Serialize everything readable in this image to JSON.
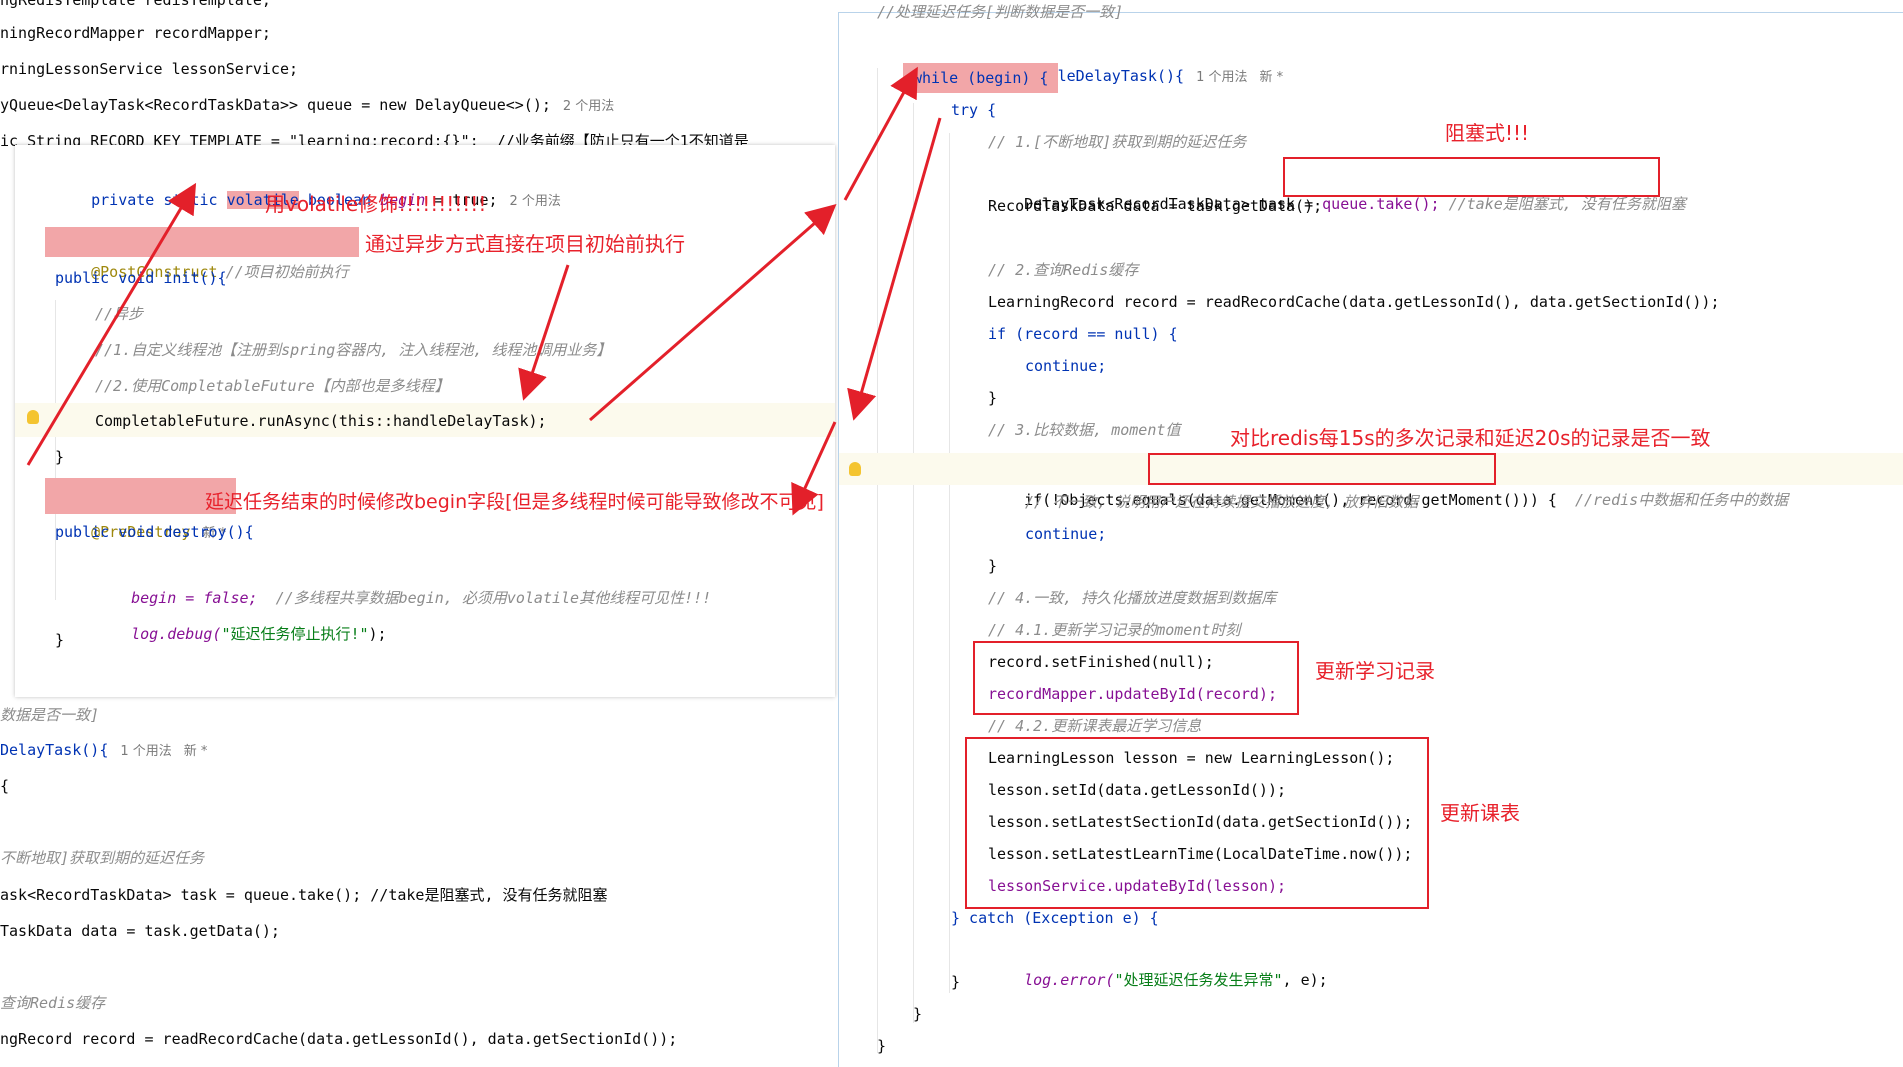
{
  "bg_lines": [
    "ngRedisTemplate redisTemplate;",
    "ningRecordMapper recordMapper;",
    "rningLessonService lessonService;",
    "yQueue<DelayTask<RecordTaskData>> queue = new DelayQueue<>();",
    "ic String RECORD_KEY_TEMPLATE = \"learning:record:{}\";  //业务前缀【防止只有一个1不知道是"
  ],
  "bg_usage_hint": "2 个用法",
  "bg_lower_lines": [
    "数据是否一致]",
    "DelayTask(){",
    "{",
    "不断地取]获取到期的延迟任务",
    "ask<RecordTaskData> task = queue.take(); //take是阻塞式, 没有任务就阻塞",
    "TaskData data = task.getData();",
    "查询Redis缓存",
    "ngRecord record = readRecordCache(data.getLessonId(), data.getSectionId());"
  ],
  "bg_lower_hints": {
    "usage": "1 个用法",
    "new": "新 *"
  },
  "left_panel": {
    "field_line": {
      "pre": "private static ",
      "kw": "volatile",
      "type": " boolean ",
      "name": "begin",
      "rest": " = true;",
      "hint": "2 个用法"
    },
    "post_construct": "@PostConstruct",
    "post_construct_comment": "//项目初始前执行",
    "init_sig": "public void init(){",
    "comment_async": "//异步",
    "comment_1": "//1.自定义线程池【注册到spring容器内, 注入线程池, 线程池调用业务】",
    "comment_2": "//2.使用CompletableFuture【内部也是多线程】",
    "run_async": "CompletableFuture.runAsync(this::handleDelayTask);",
    "close_brace": "}",
    "pre_destroy": "@PreDestroy",
    "pre_destroy_hint": "新 *",
    "destroy_sig": "public void destroy(){",
    "begin_assign": "begin = false;",
    "begin_comment": "//多线程共享数据begin, 必须用volatile其他线程可见性!!!",
    "log_debug_pre": "log.debug(",
    "log_debug_str": "\"延迟任务停止执行!\"",
    "log_debug_post": ");",
    "end_brace": "}"
  },
  "right_panel": {
    "top_comment": "//处理延迟任务[判断数据是否一致]",
    "method_sig": "public void handleDelayTask(){",
    "usage_hint": "1 个用法",
    "new_hint": "新 *",
    "while_line": "while (begin) {",
    "try_line": "try {",
    "c1": "// 1.[不断地取]获取到期的延迟任务",
    "take_pre": "DelayTask<RecordTaskData> task = ",
    "take_call": "queue.take();",
    "take_comment": " //take是阻塞式, 没有任务就阻塞",
    "data_line": "RecordTaskData data = task.getData();",
    "c2": "// 2.查询Redis缓存",
    "read_line": "LearningRecord record = readRecordCache(data.getLessonId(), data.getSectionId());",
    "if_null": "if (record == null) {",
    "continue1": "continue;",
    "brace1": "}",
    "c3": "// 3.比较数据, moment值",
    "if_equals": "if(!Objects.equals(data.getMoment(), record.getMoment())) {",
    "if_equals_comment": "//redis中数据和任务中的数据",
    "c3b": "// 不一致, 说明用户还在持续提交播放进度, 放弃旧数据",
    "continue2": "continue;",
    "brace2": "}",
    "c4": "// 4.一致, 持久化播放进度数据到数据库",
    "c41": "// 4.1.更新学习记录的moment时刻",
    "set_finished": "record.setFinished(null);",
    "mapper_update": "recordMapper.updateById(record);",
    "c42": "// 4.2.更新课表最近学习信息",
    "new_lesson": "LearningLesson lesson = new LearningLesson();",
    "set_id": "lesson.setId(data.getLessonId());",
    "set_section": "lesson.setLatestSectionId(data.getSectionId());",
    "set_time": "lesson.setLatestLearnTime(LocalDateTime.now());",
    "service_update": "lessonService.updateById(lesson);",
    "catch_line": "} catch (Exception e) {",
    "log_error_pre": "log.error(",
    "log_error_str": "\"处理延迟任务发生异常\"",
    "log_error_post": ", e);",
    "brace3": "}",
    "brace4": "}",
    "brace5": "}"
  },
  "annotations": {
    "volatile_note": "用volatile修饰!!!!!!!!!!!",
    "async_note": "通过异步方式直接在项目初始前执行",
    "destroy_note": "延迟任务结束的时候修改begin字段[但是多线程时候可能导致修改不可见]",
    "blocking_note": "阻塞式!!!",
    "compare_note": "对比redis每15s的多次记录和延迟20s的记录是否一致",
    "update_record_note": "更新学习记录",
    "update_lesson_note": "更新课表"
  },
  "colors": {
    "annotation_red": "#e3202a",
    "highlight_pink": "#f2a6a8",
    "keyword_blue": "#0033b3",
    "field_purple": "#871094"
  }
}
